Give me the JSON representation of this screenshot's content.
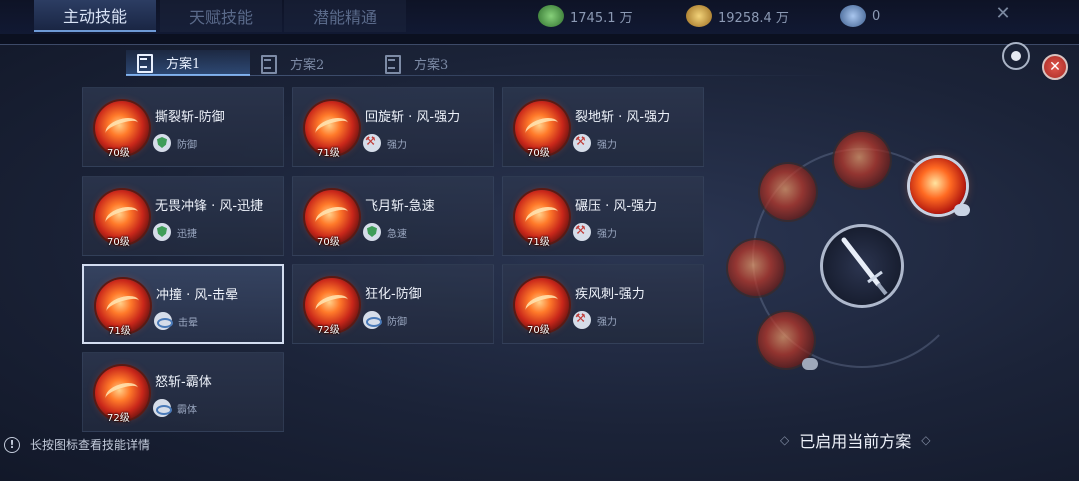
{
  "top_tabs": [
    {
      "label": "主动技能"
    },
    {
      "label": "天赋技能"
    },
    {
      "label": "潜能精通"
    }
  ],
  "resources": [
    {
      "icon": "green-leaf-icon",
      "value": "1745.1 万"
    },
    {
      "icon": "gold-coin-icon",
      "value": "19258.4 万"
    },
    {
      "icon": "crystal-icon",
      "value": "0"
    }
  ],
  "plan_tabs": [
    {
      "label": "方案1"
    },
    {
      "label": "方案2"
    },
    {
      "label": "方案3"
    }
  ],
  "skills": [
    {
      "name": "撕裂斩-防御",
      "level": "70级",
      "tag": "防御"
    },
    {
      "name": "回旋斩 · 风-强力",
      "level": "71级",
      "tag": "强力"
    },
    {
      "name": "裂地斩 · 风-强力",
      "level": "70级",
      "tag": "强力"
    },
    {
      "name": "无畏冲锋 · 风-迅捷",
      "level": "70级",
      "tag": "迅捷"
    },
    {
      "name": "飞月斩-急速",
      "level": "70级",
      "tag": "急速"
    },
    {
      "name": "碾压 · 风-强力",
      "level": "71级",
      "tag": "强力"
    },
    {
      "name": "冲撞 · 风-击晕",
      "level": "71级",
      "tag": "击晕"
    },
    {
      "name": "狂化-防御",
      "level": "72级",
      "tag": "防御"
    },
    {
      "name": "疾风刺-强力",
      "level": "70级",
      "tag": "强力"
    },
    {
      "name": "怒斩-霸体",
      "level": "72级",
      "tag": "霸体"
    }
  ],
  "hint": {
    "text": "长按图标查看技能详情",
    "icon": "exclamation-icon"
  },
  "applied_text": "已启用当前方案",
  "close_icon": "close-icon",
  "colors": {
    "accent": "#7eb2f0",
    "close": "#c8352d",
    "skill_fire": "#ff6a22"
  }
}
